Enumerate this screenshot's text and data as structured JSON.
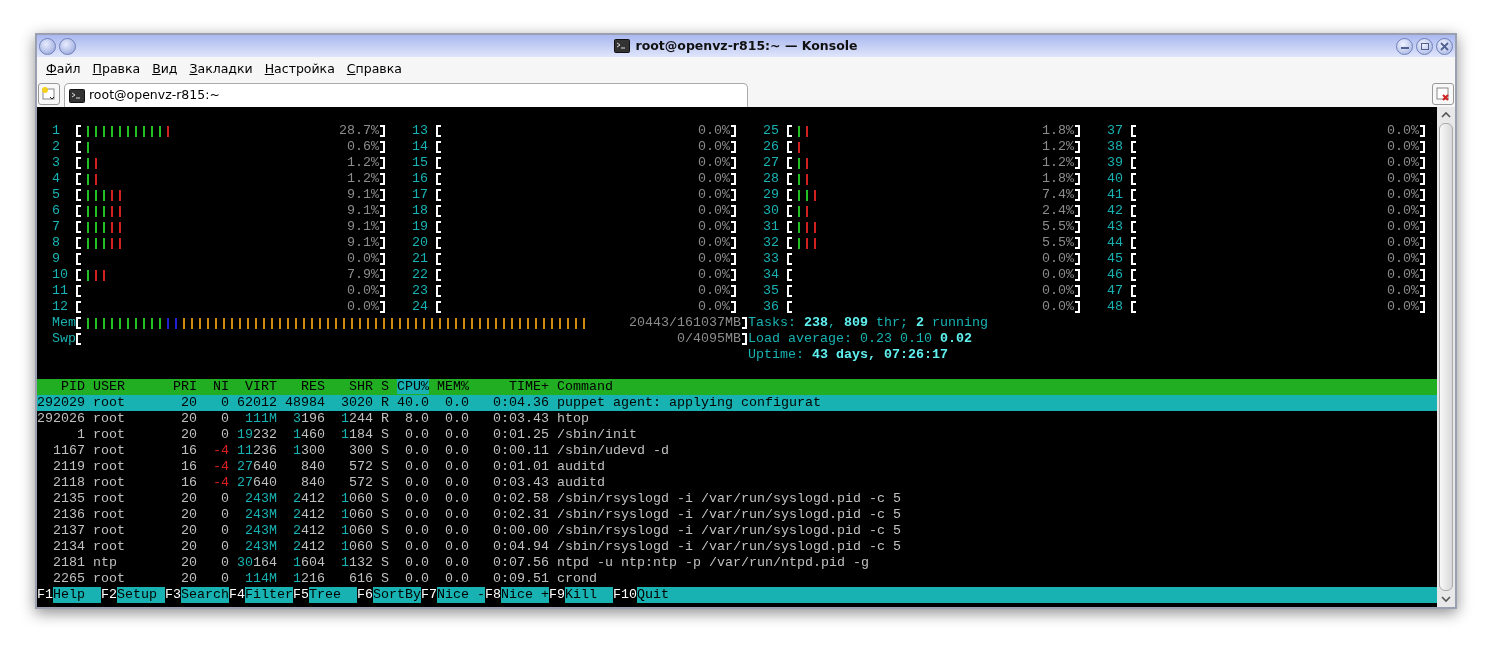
{
  "window": {
    "title": "root@openvz-r815:~ — Konsole"
  },
  "menu": [
    "Файл",
    "Правка",
    "Вид",
    "Закладки",
    "Настройка",
    "Справка"
  ],
  "tabs": [
    {
      "label": "root@openvz-r815:~",
      "selected": true
    }
  ],
  "cpu_meters": [
    {
      "label": "1",
      "reading": "28.7%",
      "bars": [
        {
          "color": "#22c022"
        },
        {
          "color": "#22c022"
        },
        {
          "color": "#22c022"
        },
        {
          "color": "#22c022"
        },
        {
          "color": "#22c022"
        },
        {
          "color": "#22c022"
        },
        {
          "color": "#22c022"
        },
        {
          "color": "#22c022"
        },
        {
          "color": "#22c022"
        },
        {
          "color": "#22c022"
        },
        {
          "color": "#d02020"
        }
      ]
    },
    {
      "label": "2",
      "reading": "0.6%",
      "bars": [
        {
          "color": "#22c022"
        }
      ]
    },
    {
      "label": "3",
      "reading": "1.2%",
      "bars": [
        {
          "color": "#22c022"
        },
        {
          "color": "#d02020"
        }
      ]
    },
    {
      "label": "4",
      "reading": "1.2%",
      "bars": [
        {
          "color": "#22c022"
        },
        {
          "color": "#d02020"
        }
      ]
    },
    {
      "label": "5",
      "reading": "9.1%",
      "bars": [
        {
          "color": "#22c022"
        },
        {
          "color": "#22c022"
        },
        {
          "color": "#22c022"
        },
        {
          "color": "#d02020"
        },
        {
          "color": "#d02020"
        }
      ]
    },
    {
      "label": "6",
      "reading": "9.1%",
      "bars": [
        {
          "color": "#22c022"
        },
        {
          "color": "#22c022"
        },
        {
          "color": "#22c022"
        },
        {
          "color": "#d02020"
        },
        {
          "color": "#d02020"
        }
      ]
    },
    {
      "label": "7",
      "reading": "9.1%",
      "bars": [
        {
          "color": "#22c022"
        },
        {
          "color": "#22c022"
        },
        {
          "color": "#22c022"
        },
        {
          "color": "#d02020"
        },
        {
          "color": "#d02020"
        }
      ]
    },
    {
      "label": "8",
      "reading": "9.1%",
      "bars": [
        {
          "color": "#22c022"
        },
        {
          "color": "#22c022"
        },
        {
          "color": "#22c022"
        },
        {
          "color": "#d02020"
        },
        {
          "color": "#d02020"
        }
      ]
    },
    {
      "label": "9",
      "reading": "0.0%"
    },
    {
      "label": "10",
      "reading": "7.9%",
      "bars": [
        {
          "color": "#22c022"
        },
        {
          "color": "#d02020"
        },
        {
          "color": "#d02020"
        }
      ]
    },
    {
      "label": "11",
      "reading": "0.0%"
    },
    {
      "label": "12",
      "reading": "0.0%"
    },
    {
      "label": "13",
      "reading": "0.0%"
    },
    {
      "label": "14",
      "reading": "0.0%"
    },
    {
      "label": "15",
      "reading": "0.0%"
    },
    {
      "label": "16",
      "reading": "0.0%"
    },
    {
      "label": "17",
      "reading": "0.0%"
    },
    {
      "label": "18",
      "reading": "0.0%"
    },
    {
      "label": "19",
      "reading": "0.0%"
    },
    {
      "label": "20",
      "reading": "0.0%"
    },
    {
      "label": "21",
      "reading": "0.0%"
    },
    {
      "label": "22",
      "reading": "0.0%"
    },
    {
      "label": "23",
      "reading": "0.0%"
    },
    {
      "label": "24",
      "reading": "0.0%"
    },
    {
      "label": "25",
      "reading": "1.8%",
      "bars": [
        {
          "color": "#22c022"
        },
        {
          "color": "#d02020"
        }
      ]
    },
    {
      "label": "26",
      "reading": "1.2%",
      "bars": [
        {
          "color": "#d02020"
        }
      ]
    },
    {
      "label": "27",
      "reading": "1.2%",
      "bars": [
        {
          "color": "#22c022"
        },
        {
          "color": "#d02020"
        }
      ]
    },
    {
      "label": "28",
      "reading": "1.8%",
      "bars": [
        {
          "color": "#22c022"
        },
        {
          "color": "#d02020"
        }
      ]
    },
    {
      "label": "29",
      "reading": "7.4%",
      "bars": [
        {
          "color": "#22c022"
        },
        {
          "color": "#22c022"
        },
        {
          "color": "#d02020"
        }
      ]
    },
    {
      "label": "30",
      "reading": "2.4%",
      "bars": [
        {
          "color": "#22c022"
        },
        {
          "color": "#d02020"
        }
      ]
    },
    {
      "label": "31",
      "reading": "5.5%",
      "bars": [
        {
          "color": "#22c022"
        },
        {
          "color": "#d02020"
        },
        {
          "color": "#d02020"
        }
      ]
    },
    {
      "label": "32",
      "reading": "5.5%",
      "bars": [
        {
          "color": "#22c022"
        },
        {
          "color": "#d02020"
        },
        {
          "color": "#d02020"
        }
      ]
    },
    {
      "label": "33",
      "reading": "0.0%"
    },
    {
      "label": "34",
      "reading": "0.0%"
    },
    {
      "label": "35",
      "reading": "0.0%"
    },
    {
      "label": "36",
      "reading": "0.0%"
    },
    {
      "label": "37",
      "reading": "0.0%"
    },
    {
      "label": "38",
      "reading": "0.0%"
    },
    {
      "label": "39",
      "reading": "0.0%"
    },
    {
      "label": "40",
      "reading": "0.0%"
    },
    {
      "label": "41",
      "reading": "0.0%"
    },
    {
      "label": "42",
      "reading": "0.0%"
    },
    {
      "label": "43",
      "reading": "0.0%"
    },
    {
      "label": "44",
      "reading": "0.0%"
    },
    {
      "label": "45",
      "reading": "0.0%"
    },
    {
      "label": "46",
      "reading": "0.0%"
    },
    {
      "label": "47",
      "reading": "0.0%"
    },
    {
      "label": "48",
      "reading": "0.0%"
    }
  ],
  "memory_meters": [
    {
      "label": "Mem",
      "reading": "20443/161037MB",
      "bars": [
        {
          "color": "#22c022"
        },
        {
          "color": "#22c022"
        },
        {
          "color": "#22c022"
        },
        {
          "color": "#22c022"
        },
        {
          "color": "#22c022"
        },
        {
          "color": "#22c022"
        },
        {
          "color": "#22c022"
        },
        {
          "color": "#22c022"
        },
        {
          "color": "#22c022"
        },
        {
          "color": "#22c022"
        },
        {
          "color": "#2020d0"
        },
        {
          "color": "#2020d0"
        },
        {
          "color": "#d08a10"
        },
        {
          "color": "#d08a10"
        },
        {
          "color": "#d08a10"
        },
        {
          "color": "#d08a10"
        },
        {
          "color": "#d08a10"
        },
        {
          "color": "#d08a10"
        },
        {
          "color": "#d08a10"
        },
        {
          "color": "#d08a10"
        },
        {
          "color": "#d08a10"
        },
        {
          "color": "#d08a10"
        },
        {
          "color": "#d08a10"
        },
        {
          "color": "#d08a10"
        },
        {
          "color": "#d08a10"
        },
        {
          "color": "#d08a10"
        },
        {
          "color": "#d08a10"
        },
        {
          "color": "#d08a10"
        },
        {
          "color": "#d08a10"
        },
        {
          "color": "#d08a10"
        },
        {
          "color": "#d08a10"
        },
        {
          "color": "#d08a10"
        },
        {
          "color": "#d08a10"
        },
        {
          "color": "#d08a10"
        },
        {
          "color": "#d08a10"
        },
        {
          "color": "#d08a10"
        },
        {
          "color": "#d08a10"
        },
        {
          "color": "#d08a10"
        },
        {
          "color": "#d08a10"
        },
        {
          "color": "#d08a10"
        },
        {
          "color": "#d08a10"
        },
        {
          "color": "#d08a10"
        },
        {
          "color": "#d08a10"
        },
        {
          "color": "#d08a10"
        },
        {
          "color": "#d08a10"
        },
        {
          "color": "#d08a10"
        },
        {
          "color": "#d08a10"
        },
        {
          "color": "#d08a10"
        },
        {
          "color": "#d08a10"
        },
        {
          "color": "#d08a10"
        },
        {
          "color": "#d08a10"
        },
        {
          "color": "#d08a10"
        },
        {
          "color": "#d08a10"
        },
        {
          "color": "#d08a10"
        },
        {
          "color": "#d08a10"
        },
        {
          "color": "#d08a10"
        },
        {
          "color": "#d08a10"
        },
        {
          "color": "#d08a10"
        },
        {
          "color": "#d08a10"
        },
        {
          "color": "#d08a10"
        },
        {
          "color": "#d08a10"
        },
        {
          "color": "#d08a10"
        },
        {
          "color": "#d08a10"
        }
      ]
    },
    {
      "label": "Swp",
      "reading": "0/4095MB"
    }
  ],
  "summary": [
    "Tasks: **238**, **809** thr; **2** running",
    "Load average: 0.23 0.10 **0.02**",
    "Uptime: **43 days, 07:26:17**"
  ],
  "process_table": {
    "columns": [
      {
        "label": "PID",
        "selected": false
      },
      {
        "label": "USER",
        "selected": false
      },
      {
        "label": "PRI",
        "selected": false
      },
      {
        "label": "NI",
        "selected": false
      },
      {
        "label": "VIRT",
        "selected": false
      },
      {
        "label": "RES",
        "selected": false
      },
      {
        "label": "SHR",
        "selected": false
      },
      {
        "label": "S",
        "selected": false
      },
      {
        "label": "CPU%",
        "selected": true
      },
      {
        "label": "MEM%",
        "selected": false
      },
      {
        "label": "TIME+",
        "selected": false
      },
      {
        "label": "Command",
        "selected": false
      }
    ],
    "rows": [
      {
        "selected": true,
        "cells": [
          "292029",
          "root",
          "20",
          "0",
          "62012",
          "48984",
          "3020",
          "R",
          "40.0",
          "0.0",
          "0:04.36",
          "puppet agent: applying configurat"
        ]
      },
      {
        "selected": false,
        "cells": [
          "292026",
          "root",
          "20",
          "0",
          "111M",
          "3196",
          "1244",
          "R",
          "8.0",
          "0.0",
          "0:03.43",
          "htop"
        ]
      },
      {
        "selected": false,
        "cells": [
          "1",
          "root",
          "20",
          "0",
          "19232",
          "1460",
          "1184",
          "S",
          "0.0",
          "0.0",
          "0:01.25",
          "/sbin/init"
        ]
      },
      {
        "selected": false,
        "cells": [
          "1167",
          "root",
          "16",
          "-4",
          "11236",
          "1300",
          "300",
          "S",
          "0.0",
          "0.0",
          "0:00.11",
          "/sbin/udevd -d"
        ]
      },
      {
        "selected": false,
        "cells": [
          "2119",
          "root",
          "16",
          "-4",
          "27640",
          "840",
          "572",
          "S",
          "0.0",
          "0.0",
          "0:01.01",
          "auditd"
        ]
      },
      {
        "selected": false,
        "cells": [
          "2118",
          "root",
          "16",
          "-4",
          "27640",
          "840",
          "572",
          "S",
          "0.0",
          "0.0",
          "0:03.43",
          "auditd"
        ]
      },
      {
        "selected": false,
        "cells": [
          "2135",
          "root",
          "20",
          "0",
          "243M",
          "2412",
          "1060",
          "S",
          "0.0",
          "0.0",
          "0:02.58",
          "/sbin/rsyslogd -i /var/run/syslogd.pid -c 5"
        ]
      },
      {
        "selected": false,
        "cells": [
          "2136",
          "root",
          "20",
          "0",
          "243M",
          "2412",
          "1060",
          "S",
          "0.0",
          "0.0",
          "0:02.31",
          "/sbin/rsyslogd -i /var/run/syslogd.pid -c 5"
        ]
      },
      {
        "selected": false,
        "cells": [
          "2137",
          "root",
          "20",
          "0",
          "243M",
          "2412",
          "1060",
          "S",
          "0.0",
          "0.0",
          "0:00.00",
          "/sbin/rsyslogd -i /var/run/syslogd.pid -c 5"
        ]
      },
      {
        "selected": false,
        "cells": [
          "2134",
          "root",
          "20",
          "0",
          "243M",
          "2412",
          "1060",
          "S",
          "0.0",
          "0.0",
          "0:04.94",
          "/sbin/rsyslogd -i /var/run/syslogd.pid -c 5"
        ]
      },
      {
        "selected": false,
        "cells": [
          "2181",
          "ntp",
          "20",
          "0",
          "30164",
          "1604",
          "1132",
          "S",
          "0.0",
          "0.0",
          "0:07.56",
          "ntpd -u ntp:ntp -p /var/run/ntpd.pid -g"
        ]
      },
      {
        "selected": false,
        "cells": [
          "2265",
          "root",
          "20",
          "0",
          "114M",
          "1216",
          "616",
          "S",
          "0.0",
          "0.0",
          "0:09.51",
          "crond"
        ]
      }
    ]
  },
  "function_keys": [
    {
      "key": "F1",
      "label": "Help"
    },
    {
      "key": "F2",
      "label": "Setup"
    },
    {
      "key": "F3",
      "label": "Search"
    },
    {
      "key": "F4",
      "label": "Filter"
    },
    {
      "key": "F5",
      "label": "Tree"
    },
    {
      "key": "F6",
      "label": "SortBy"
    },
    {
      "key": "F7",
      "label": "Nice -"
    },
    {
      "key": "F8",
      "label": "Nice +"
    },
    {
      "key": "F9",
      "label": "Kill"
    },
    {
      "key": "F10",
      "label": "Quit"
    }
  ]
}
